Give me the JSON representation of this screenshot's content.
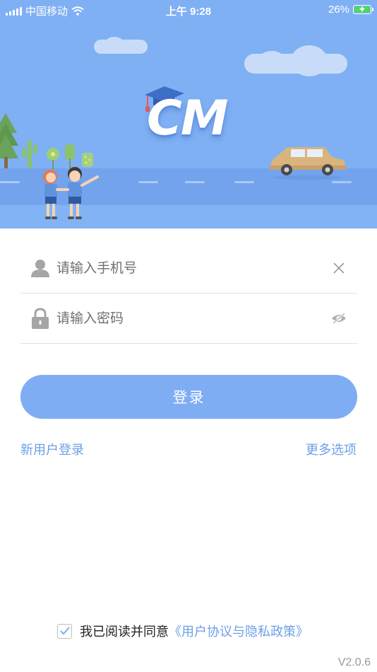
{
  "status_bar": {
    "carrier": "中国移动",
    "time": "上午 9:28",
    "battery_percent": "26%",
    "battery_level": 0.26,
    "icons": [
      "signal-icon",
      "wifi-icon",
      "battery-icon"
    ]
  },
  "hero": {
    "logo_text": "CM",
    "background_color": "#7fb0f4"
  },
  "form": {
    "phone": {
      "placeholder": "请输入手机号",
      "value": "",
      "icon": "user-icon",
      "action_icon": "clear-icon"
    },
    "password": {
      "placeholder": "请输入密码",
      "value": "",
      "icon": "lock-icon",
      "action_icon": "eye-hidden-icon"
    }
  },
  "actions": {
    "login_label": "登录",
    "new_user_label": "新用户登录",
    "more_options_label": "更多选项"
  },
  "agreement": {
    "checked": true,
    "text": "我已阅读并同意",
    "link_text": "《用户协议与隐私政策》"
  },
  "version": "V2.0.6",
  "colors": {
    "accent": "#7eadf4",
    "link": "#6d9fe8"
  }
}
